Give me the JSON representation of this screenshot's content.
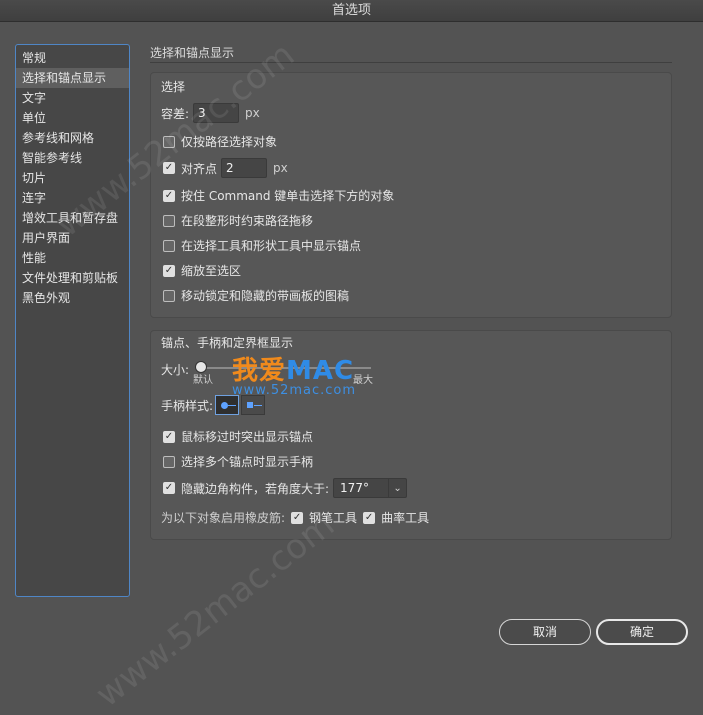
{
  "window": {
    "title": "首选项"
  },
  "sidebar": {
    "items": [
      {
        "label": "常规"
      },
      {
        "label": "选择和锚点显示",
        "active": true
      },
      {
        "label": "文字"
      },
      {
        "label": "单位"
      },
      {
        "label": "参考线和网格"
      },
      {
        "label": "智能参考线"
      },
      {
        "label": "切片"
      },
      {
        "label": "连字"
      },
      {
        "label": "增效工具和暂存盘"
      },
      {
        "label": "用户界面"
      },
      {
        "label": "性能"
      },
      {
        "label": "文件处理和剪贴板"
      },
      {
        "label": "黑色外观"
      }
    ]
  },
  "main": {
    "section_title": "选择和锚点显示",
    "selection": {
      "title": "选择",
      "tolerance_label": "容差:",
      "tolerance_value": "3",
      "tolerance_unit": "px",
      "options": [
        {
          "label": "仅按路径选择对象",
          "checked": false
        },
        {
          "label": "对齐点",
          "checked": true,
          "value": "2",
          "unit": "px"
        },
        {
          "label": "按住 Command 键单击选择下方的对象",
          "checked": true
        },
        {
          "label": "在段整形时约束路径拖移",
          "checked": false
        },
        {
          "label": "在选择工具和形状工具中显示锚点",
          "checked": false
        },
        {
          "label": "缩放至选区",
          "checked": true
        },
        {
          "label": "移动锁定和隐藏的带画板的图稿",
          "checked": false
        }
      ]
    },
    "anchor": {
      "title": "锚点、手柄和定界框显示",
      "size_label": "大小:",
      "size_min_label": "默认",
      "size_max_label": "最大",
      "size_value_fraction": 0,
      "handle_style_label": "手柄样式:",
      "options": [
        {
          "label": "鼠标移过时突出显示锚点",
          "checked": true
        },
        {
          "label": "选择多个锚点时显示手柄",
          "checked": false
        },
        {
          "label": "隐藏边角构件，若角度大于:",
          "checked": true
        }
      ],
      "angle_value": "177°",
      "rubber_band_label": "为以下对象启用橡皮筋:",
      "rubber_band_items": [
        {
          "label": "钢笔工具",
          "checked": true
        },
        {
          "label": "曲率工具",
          "checked": true
        }
      ]
    }
  },
  "buttons": {
    "cancel": "取消",
    "ok": "确定"
  },
  "watermark": {
    "text": "www.52mac.com",
    "logo_prefix": "我爱",
    "logo_brand": "MAC",
    "logo_url": "www.52mac.com"
  },
  "colors": {
    "accent": "#4f86c6",
    "background": "#535353"
  }
}
